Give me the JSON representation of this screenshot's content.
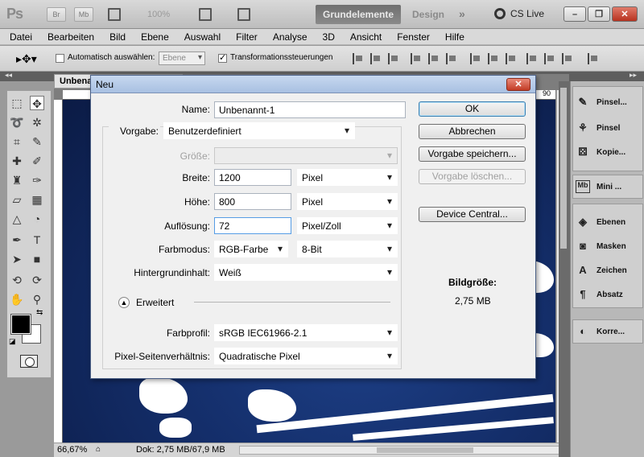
{
  "app": {
    "logo": "Ps",
    "br_label": "Br",
    "mb_label": "Mb",
    "zoom": "100%",
    "workspace_active": "Grundelemente",
    "workspace_other": "Design",
    "workspace_more": "»",
    "cslive": "CS Live"
  },
  "menu": [
    "Datei",
    "Bearbeiten",
    "Bild",
    "Ebene",
    "Auswahl",
    "Filter",
    "Analyse",
    "3D",
    "Ansicht",
    "Fenster",
    "Hilfe"
  ],
  "options": {
    "auto_select_label": "Automatisch auswählen:",
    "auto_select_value": "Ebene",
    "transform_label": "Transformationssteuerungen"
  },
  "document": {
    "tab_title": "Unbenannt",
    "ruler_right": "90",
    "zoom_status": "66,67%",
    "doc_status": "Dok: 2,75 MB/67,9 MB"
  },
  "panels": [
    {
      "label": "Pinsel...",
      "icon": "brush-icon"
    },
    {
      "label": "Pinsel",
      "icon": "brush-tip-icon"
    },
    {
      "label": "Kopie...",
      "icon": "clone-source-icon"
    },
    {
      "label": "Mini ...",
      "icon": "mini-bridge-icon"
    },
    {
      "label": "Ebenen",
      "icon": "layers-icon"
    },
    {
      "label": "Masken",
      "icon": "masks-icon"
    },
    {
      "label": "Zeichen",
      "icon": "character-icon"
    },
    {
      "label": "Absatz",
      "icon": "paragraph-icon"
    },
    {
      "label": "Korre...",
      "icon": "adjustments-icon"
    }
  ],
  "dialog": {
    "title": "Neu",
    "name_label": "Name:",
    "name_value": "Unbenannt-1",
    "preset_label": "Vorgabe:",
    "preset_value": "Benutzerdefiniert",
    "size_label": "Größe:",
    "size_value": "",
    "width_label": "Breite:",
    "width_value": "1200",
    "width_unit": "Pixel",
    "height_label": "Höhe:",
    "height_value": "800",
    "height_unit": "Pixel",
    "resolution_label": "Auflösung:",
    "resolution_value": "72",
    "resolution_unit": "Pixel/Zoll",
    "colormode_label": "Farbmodus:",
    "colormode_value": "RGB-Farbe",
    "bitdepth_value": "8-Bit",
    "background_label": "Hintergrundinhalt:",
    "background_value": "Weiß",
    "advanced_label": "Erweitert",
    "profile_label": "Farbprofil:",
    "profile_value": "sRGB IEC61966-2.1",
    "pixelaspect_label": "Pixel-Seitenverhältnis:",
    "pixelaspect_value": "Quadratische Pixel",
    "btn_ok": "OK",
    "btn_cancel": "Abbrechen",
    "btn_save_preset": "Vorgabe speichern...",
    "btn_delete_preset": "Vorgabe löschen...",
    "btn_device_central": "Device Central...",
    "image_size_label": "Bildgröße:",
    "image_size_value": "2,75 MB"
  }
}
